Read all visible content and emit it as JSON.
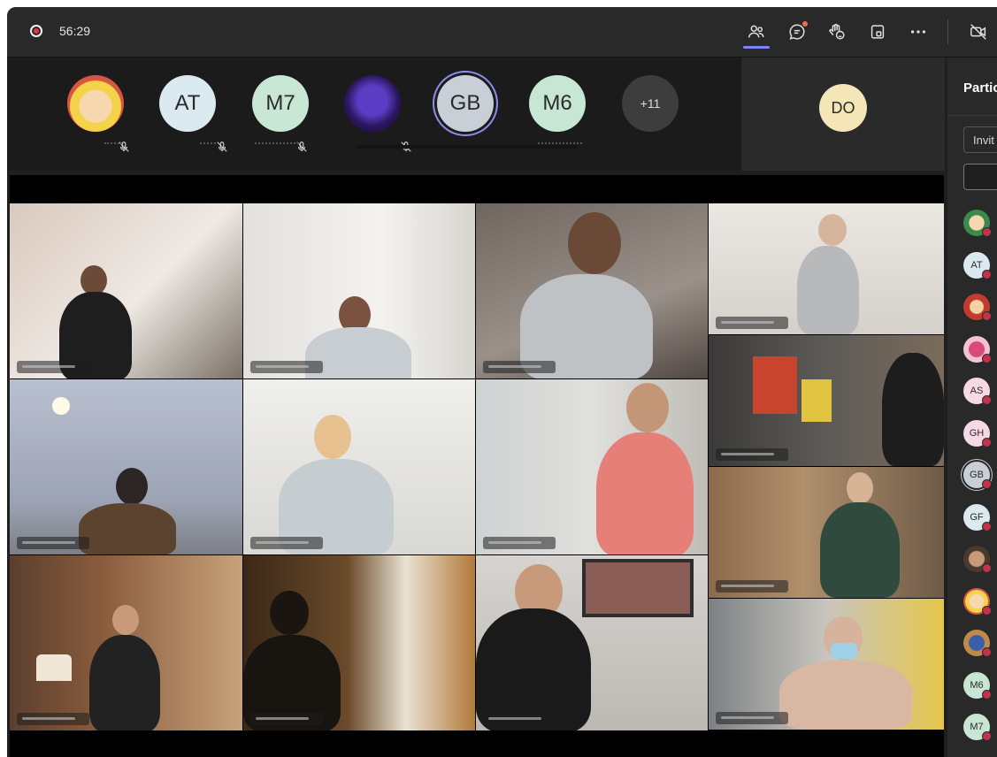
{
  "call": {
    "timer": "56:29",
    "recording": true
  },
  "toolbar": {
    "icons": [
      "people-icon",
      "chat-icon",
      "reactions-icon",
      "rooms-icon",
      "more-icon",
      "camera-off-icon"
    ],
    "chat_badge_color": "#e8734a",
    "active_underline_color": "#7f85f5"
  },
  "avatars": [
    {
      "initials": "",
      "icon": "sailor-moon-avatar"
    },
    {
      "initials": "AT"
    },
    {
      "initials": "M7"
    },
    {
      "initials": "",
      "icon": "purple-character-avatar"
    },
    {
      "initials": "GB"
    },
    {
      "initials": "M6"
    },
    {
      "initials": "+11"
    }
  ],
  "spotlight": {
    "initials": "DO"
  },
  "panel": {
    "title": "Partic",
    "invite_label": "Invit",
    "participants": [
      {
        "initials": "",
        "icon": "photo-avatar-1"
      },
      {
        "initials": "AT"
      },
      {
        "initials": "",
        "icon": "photo-avatar-2"
      },
      {
        "initials": "",
        "icon": "photo-avatar-3"
      },
      {
        "initials": "AS"
      },
      {
        "initials": "GH"
      },
      {
        "initials": "GB",
        "selected": true
      },
      {
        "initials": "GF"
      },
      {
        "initials": "",
        "icon": "photo-avatar-4"
      },
      {
        "initials": "",
        "icon": "photo-avatar-5"
      },
      {
        "initials": "",
        "icon": "photo-avatar-6"
      },
      {
        "initials": "M6"
      },
      {
        "initials": "M7"
      }
    ]
  }
}
